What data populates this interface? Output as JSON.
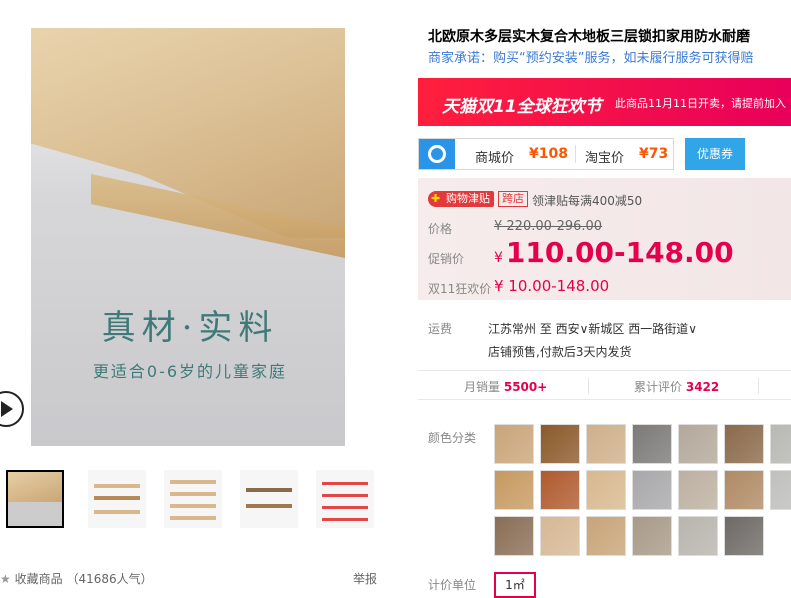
{
  "gallery": {
    "slogan": "真材·实料",
    "slogan_sub": "更适合0-6岁的儿童家庭",
    "favorite_label": "收藏商品",
    "favorite_count": "（41686人气）",
    "report_label": "举报"
  },
  "product": {
    "title": "北欧原木多层实木复合木地板三层锁扣家用防水耐磨",
    "promise": "商家承诺：购买“预约安装”服务，如未履行服务可获得赔"
  },
  "banner": {
    "main": "天猫双11全球狂欢节",
    "note": "此商品11月11日开卖，请提前加入"
  },
  "compare": {
    "mall_label": "商城价",
    "mall_price": "¥108",
    "taobao_label": "淘宝价",
    "taobao_price": "¥73",
    "coupon_label": "优惠券"
  },
  "price": {
    "jin_badge": "购物津贴",
    "kua_badge": "跨店",
    "jin_desc": "领津贴每满400减50",
    "price_label": "价格",
    "price_orig": "¥ 220.00-296.00",
    "promo_label": "促销价",
    "promo_currency": "¥",
    "promo_value": "110.00-148.00",
    "double11_label": "双11狂欢价",
    "double11_value": "¥ 10.00-148.00"
  },
  "shipping": {
    "label": "运费",
    "route": "江苏常州  至  西安∨新城区  西一路街道∨",
    "note": "店铺预售,付款后3天内发货"
  },
  "stats": {
    "monthly_label": "月销量",
    "monthly_value": "5500+",
    "reviews_label": "累计评价",
    "reviews_value": "3422"
  },
  "colors": {
    "label": "颜色分类",
    "swatches": [
      "#c9a57a",
      "#8b5a2b",
      "#cfb08a",
      "#7c7a78",
      "#b3a89a",
      "#8a6a4a",
      "#b8b8b4",
      "#c69a60",
      "#b05a2e",
      "#d8b88e",
      "#a8a8aa",
      "#bcb0a0",
      "#b08a64",
      "#c0c0be",
      "#8a6e56",
      "#d6b894",
      "#c8a478",
      "#a89a88",
      "#b8b4ae",
      "#6e6a66"
    ]
  },
  "unit": {
    "label": "计价单位",
    "option": "1㎡"
  },
  "icons": [
    "play-icon",
    "zoom-icon",
    "star-icon",
    "search-logo-icon"
  ]
}
